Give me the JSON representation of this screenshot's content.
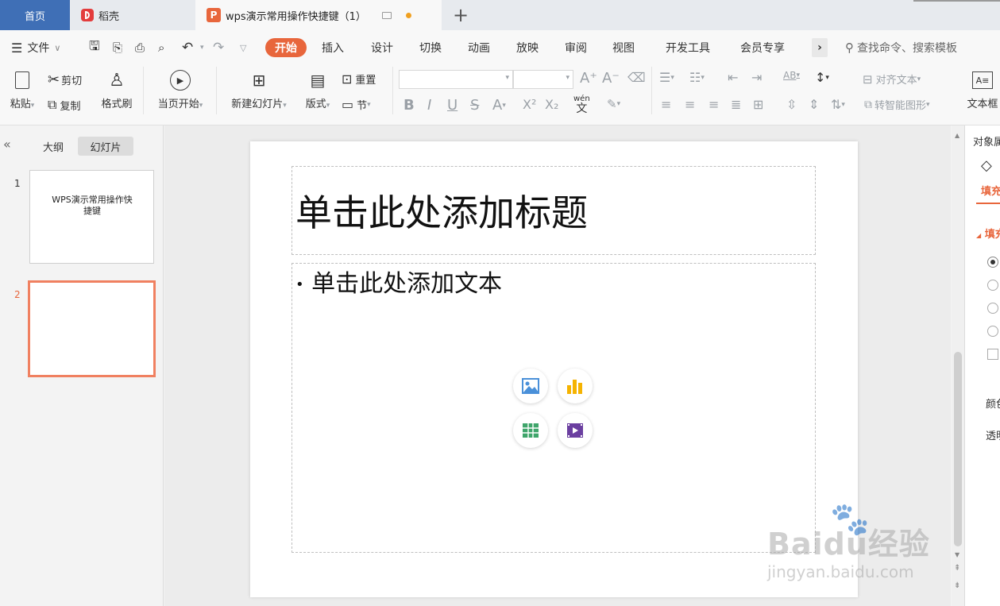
{
  "tabs": {
    "home": "首页",
    "daoke": "稻壳",
    "doc": "wps演示常用操作快捷键（1）",
    "add": "+"
  },
  "menu": {
    "file": "文件",
    "start": "开始",
    "insert": "插入",
    "design": "设计",
    "switch": "切换",
    "animation": "动画",
    "slideshow": "放映",
    "review": "审阅",
    "view": "视图",
    "devtools": "开发工具",
    "member": "会员专享",
    "more": "›",
    "search_placeholder": "查找命令、搜索模板"
  },
  "toolbar": {
    "paste": "粘贴",
    "cut": "剪切",
    "copy": "复制",
    "format_painter": "格式刷",
    "from_current": "当页开始",
    "new_slide": "新建幻灯片",
    "layout": "版式",
    "reset": "重置",
    "section": "节",
    "align_text": "对齐文本",
    "smart_art": "转智能图形",
    "text_box": "文本框",
    "pinyin_glyph": "wén"
  },
  "sidebar": {
    "collapse": "«",
    "outline": "大纲",
    "slides": "幻灯片",
    "thumbs": [
      {
        "num": "1",
        "title": "WPS演示常用操作快捷键"
      },
      {
        "num": "2",
        "title": ""
      }
    ]
  },
  "slide": {
    "title_placeholder": "单击此处添加标题",
    "body_placeholder": "单击此处添加文本",
    "bullet": "•"
  },
  "rightpanel": {
    "title": "对象属",
    "fill_tab": "填充",
    "fill_section": "填充",
    "color": "颜色",
    "transparency": "透明"
  },
  "watermark": {
    "brand": "Baidu经验",
    "url": "jingyan.baidu.com"
  },
  "colors": {
    "accent": "#e8663c",
    "home_tab": "#3f6fb6",
    "image_icon": "#4a90d9",
    "chart_icon": "#f5b301",
    "table_icon": "#3fa56b",
    "video_icon": "#6b3fa0"
  }
}
